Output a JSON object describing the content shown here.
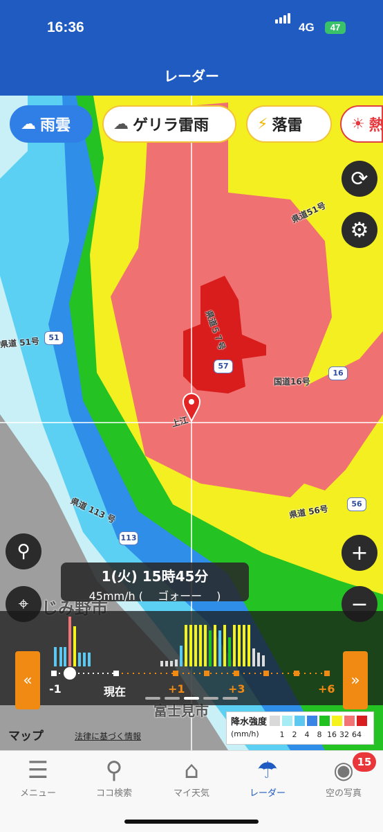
{
  "status": {
    "time": "16:36",
    "network": "4G",
    "battery": "47"
  },
  "header": {
    "title": "レーダー"
  },
  "layer_tabs": [
    {
      "label": "雨雲",
      "icon": "rain-cloud-icon",
      "active": true
    },
    {
      "label": "ゲリラ雷雨",
      "icon": "thunder-cloud-icon",
      "active": false
    },
    {
      "label": "落雷",
      "icon": "lightning-icon",
      "active": false
    },
    {
      "label": "熱",
      "icon": "sun-icon",
      "active": false
    }
  ],
  "map": {
    "road_labels": [
      "県道51号",
      "県道５７号",
      "国道16号",
      "上江",
      "県道 113 号",
      "県道 51号",
      "県道 56号",
      "じみ野市",
      "富士見市",
      "県"
    ],
    "shields": [
      "51",
      "57",
      "16",
      "56",
      "113"
    ]
  },
  "info": {
    "time_label": "1(火) 15時45分",
    "intensity": "45mm/h (　 ゴォーー　 )"
  },
  "timeline": {
    "labels": [
      "-1",
      "現在",
      "+1",
      "+3",
      "+6"
    ],
    "bar_levels": [
      0,
      0,
      0,
      0,
      0,
      0,
      0,
      0
    ]
  },
  "footer": {
    "maps_label": "マップ",
    "legal_label": "法律に基づく情報"
  },
  "legend": {
    "title": "降水強度",
    "unit": "(mm/h)",
    "values": [
      "1",
      "2",
      "4",
      "8",
      "16",
      "32",
      "64"
    ],
    "colors": [
      "#d9d9d9",
      "#a6ecf5",
      "#5cc8f0",
      "#3a84e6",
      "#1fc21f",
      "#f5f21e",
      "#f27474",
      "#d81e1e"
    ]
  },
  "tabs": [
    {
      "label": "メニュー",
      "icon": "menu-icon",
      "active": false
    },
    {
      "label": "ココ検索",
      "icon": "search-icon",
      "active": false
    },
    {
      "label": "マイ天気",
      "icon": "home-icon",
      "active": false
    },
    {
      "label": "レーダー",
      "icon": "umbrella-icon",
      "active": true
    },
    {
      "label": "空の写真",
      "icon": "camera-icon",
      "active": false
    }
  ],
  "photo_badge": "15"
}
